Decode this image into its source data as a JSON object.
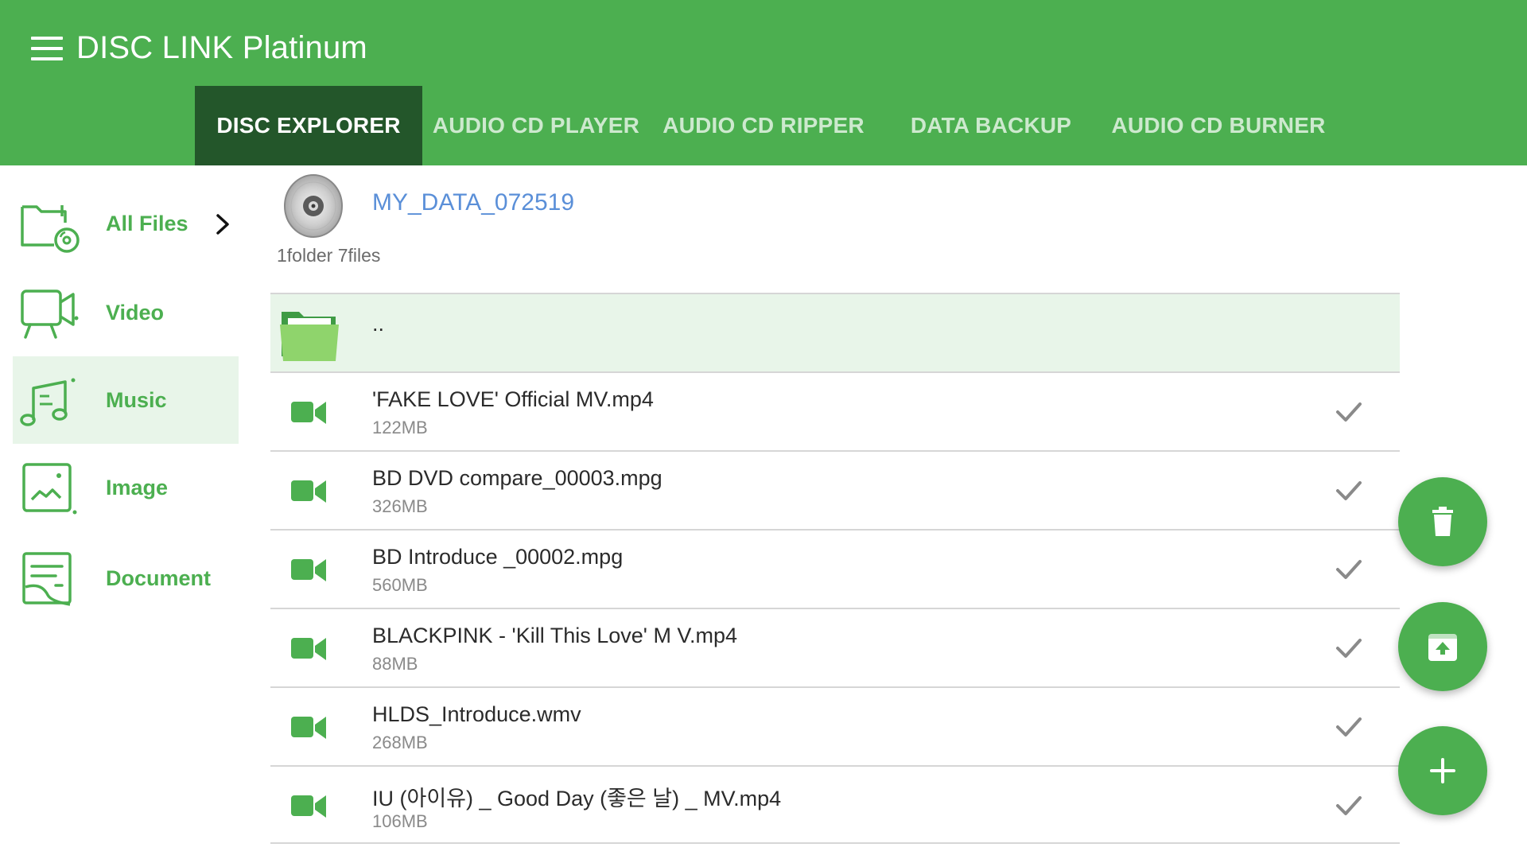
{
  "app": {
    "title": "DISC LINK Platinum",
    "accent_color": "#4caf50",
    "active_tab_color": "#23562a",
    "menu_icon": "menu-icon"
  },
  "tabs": [
    {
      "label": "DISC EXPLORER",
      "active": true
    },
    {
      "label": "AUDIO CD PLAYER",
      "active": false
    },
    {
      "label": "AUDIO CD RIPPER",
      "active": false
    },
    {
      "label": "DATA BACKUP",
      "active": false
    },
    {
      "label": "AUDIO CD BURNER",
      "active": false
    }
  ],
  "sidebar": {
    "items": [
      {
        "label": "All Files",
        "icon": "folder-disc-icon",
        "selected": false,
        "has_chevron": true
      },
      {
        "label": "Video",
        "icon": "video-camera-icon",
        "selected": false
      },
      {
        "label": "Music",
        "icon": "music-note-icon",
        "selected": true
      },
      {
        "label": "Image",
        "icon": "image-icon",
        "selected": false
      },
      {
        "label": "Document",
        "icon": "document-icon",
        "selected": false
      }
    ]
  },
  "disc": {
    "name": "MY_DATA_072519",
    "summary": "1folder 7files",
    "icon": "disc-icon"
  },
  "files": [
    {
      "name": "..",
      "size": "",
      "type": "parent-folder",
      "icon": "folder-open-icon"
    },
    {
      "name": "'FAKE LOVE' Official MV.mp4",
      "size": "122MB",
      "type": "video",
      "icon": "video-file-icon",
      "checked": true
    },
    {
      "name": "BD DVD compare_00003.mpg",
      "size": "326MB",
      "type": "video",
      "icon": "video-file-icon",
      "checked": true
    },
    {
      "name": "BD Introduce _00002.mpg",
      "size": "560MB",
      "type": "video",
      "icon": "video-file-icon",
      "checked": true
    },
    {
      "name": "BLACKPINK - 'Kill This Love' M V.mp4",
      "size": "88MB",
      "type": "video",
      "icon": "video-file-icon",
      "checked": true
    },
    {
      "name": "HLDS_Introduce.wmv",
      "size": "268MB",
      "type": "video",
      "icon": "video-file-icon",
      "checked": true
    },
    {
      "name": "IU (아이유) _ Good Day (좋은 날) _ MV.mp4",
      "size": "106MB",
      "type": "video",
      "icon": "video-file-icon",
      "checked": true
    }
  ],
  "fabs": [
    {
      "action": "delete",
      "icon": "trash-icon"
    },
    {
      "action": "upload",
      "icon": "upload-box-icon"
    },
    {
      "action": "add",
      "icon": "plus-icon"
    }
  ]
}
